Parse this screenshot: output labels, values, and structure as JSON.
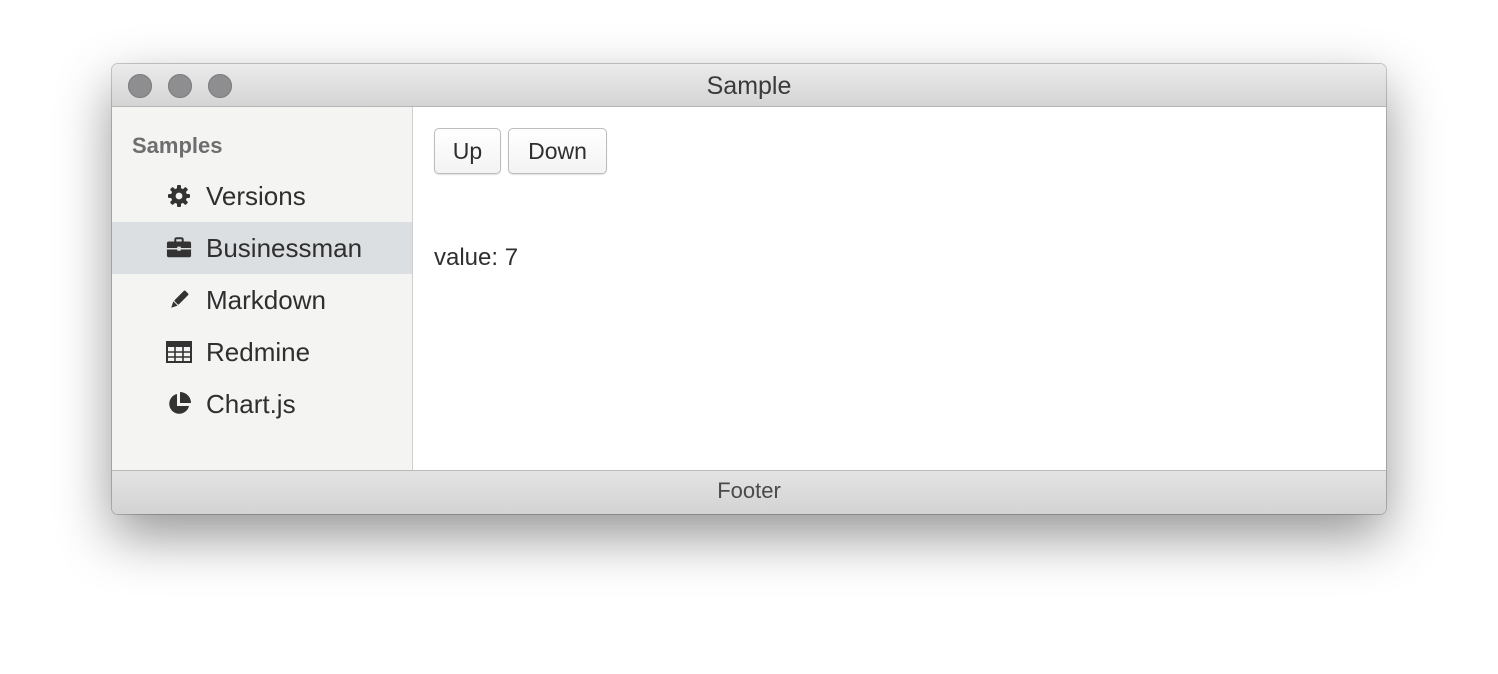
{
  "window": {
    "title": "Sample"
  },
  "sidebar": {
    "heading": "Samples",
    "items": [
      {
        "label": "Versions",
        "icon": "gear-icon",
        "active": false
      },
      {
        "label": "Businessman",
        "icon": "briefcase-icon",
        "active": true
      },
      {
        "label": "Markdown",
        "icon": "pencil-icon",
        "active": false
      },
      {
        "label": "Redmine",
        "icon": "table-icon",
        "active": false
      },
      {
        "label": "Chart.js",
        "icon": "pie-chart-icon",
        "active": false
      }
    ]
  },
  "main": {
    "up_label": "Up",
    "down_label": "Down",
    "value_text": "value: 7"
  },
  "footer": {
    "text": "Footer"
  },
  "colors": {
    "sidebar_bg": "#f4f4f3",
    "active_item_bg": "#dcdfe1",
    "text": "#2f2f2f",
    "icon": "#333333"
  }
}
